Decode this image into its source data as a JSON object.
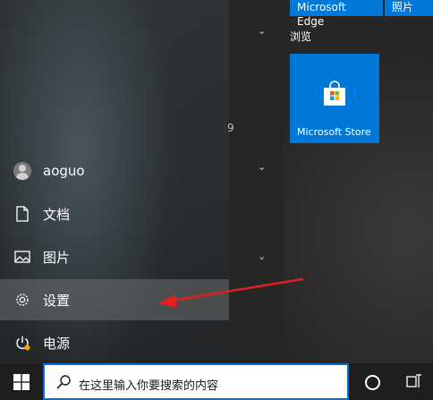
{
  "start_menu": {
    "nav": {
      "user": "aoguo",
      "documents": "文档",
      "pictures": "图片",
      "settings": "设置",
      "power": "电源"
    },
    "stray_char": "9",
    "tiles": {
      "top_tile_1": "Microsoft Edge",
      "top_tile_2": "照片",
      "group_label": "浏览",
      "store_tile": "Microsoft Store"
    }
  },
  "taskbar": {
    "search_placeholder": "在这里输入你要搜索的内容"
  },
  "colors": {
    "accent": "#0078d7",
    "annotation_arrow": "#e02020",
    "power_dot": "#f7a600"
  }
}
